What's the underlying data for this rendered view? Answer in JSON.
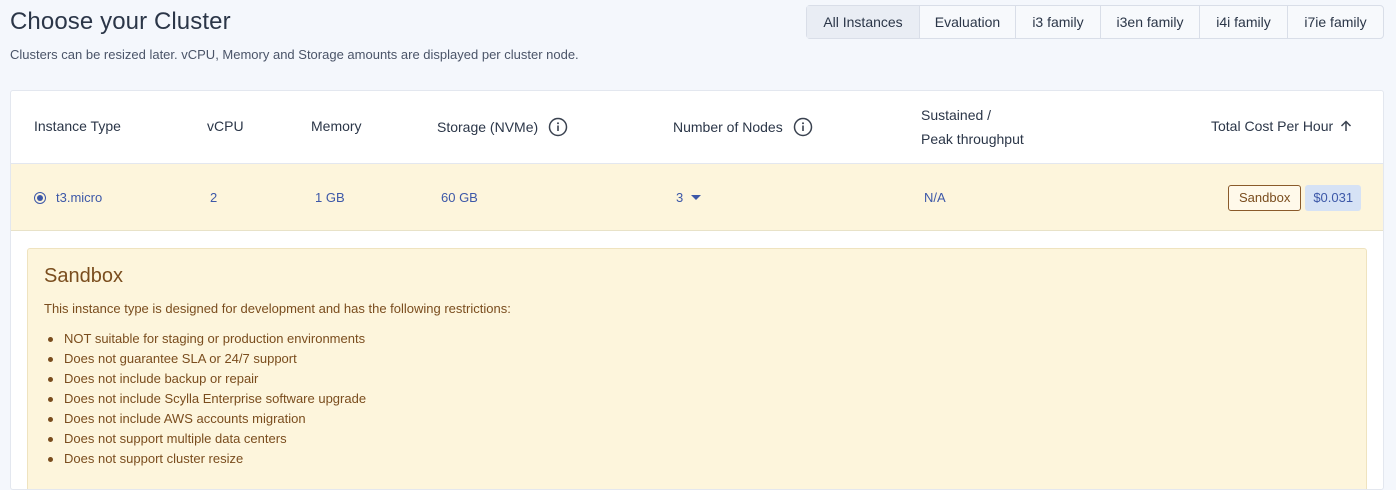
{
  "header": {
    "title": "Choose your Cluster",
    "subtitle": "Clusters can be resized later. vCPU, Memory and Storage amounts are displayed per cluster node."
  },
  "filters": [
    {
      "label": "All Instances",
      "active": true
    },
    {
      "label": "Evaluation",
      "active": false
    },
    {
      "label": "i3 family",
      "active": false
    },
    {
      "label": "i3en family",
      "active": false
    },
    {
      "label": "i4i family",
      "active": false
    },
    {
      "label": "i7ie family",
      "active": false
    }
  ],
  "table": {
    "columns": {
      "instance_type": "Instance Type",
      "vcpu": "vCPU",
      "memory": "Memory",
      "storage": "Storage (NVMe)",
      "nodes": "Number of Nodes",
      "throughput_line1": "Sustained /",
      "throughput_line2": "Peak throughput",
      "cost": "Total Cost Per Hour"
    },
    "row": {
      "instance_type": "t3.micro",
      "vcpu": "2",
      "memory": "1 GB",
      "storage": "60 GB",
      "nodes": "3",
      "throughput": "N/A",
      "badge": "Sandbox",
      "price": "$0.031",
      "selected": true
    }
  },
  "notice": {
    "title": "Sandbox",
    "description": "This instance type is designed for development and has the following restrictions:",
    "items": [
      "NOT suitable for staging or production environments",
      "Does not guarantee SLA or 24/7 support",
      "Does not include backup or repair",
      "Does not include Scylla Enterprise software upgrade",
      "Does not include AWS accounts migration",
      "Does not support multiple data centers",
      "Does not support cluster resize"
    ]
  },
  "colors": {
    "accent": "#3d58a8",
    "sandbox_bg": "#fdf5dc",
    "sandbox_text": "#7a4d1e"
  },
  "icons": {
    "info": "info-circle-icon",
    "sort": "arrow-up-icon",
    "dropdown": "caret-down-icon"
  }
}
